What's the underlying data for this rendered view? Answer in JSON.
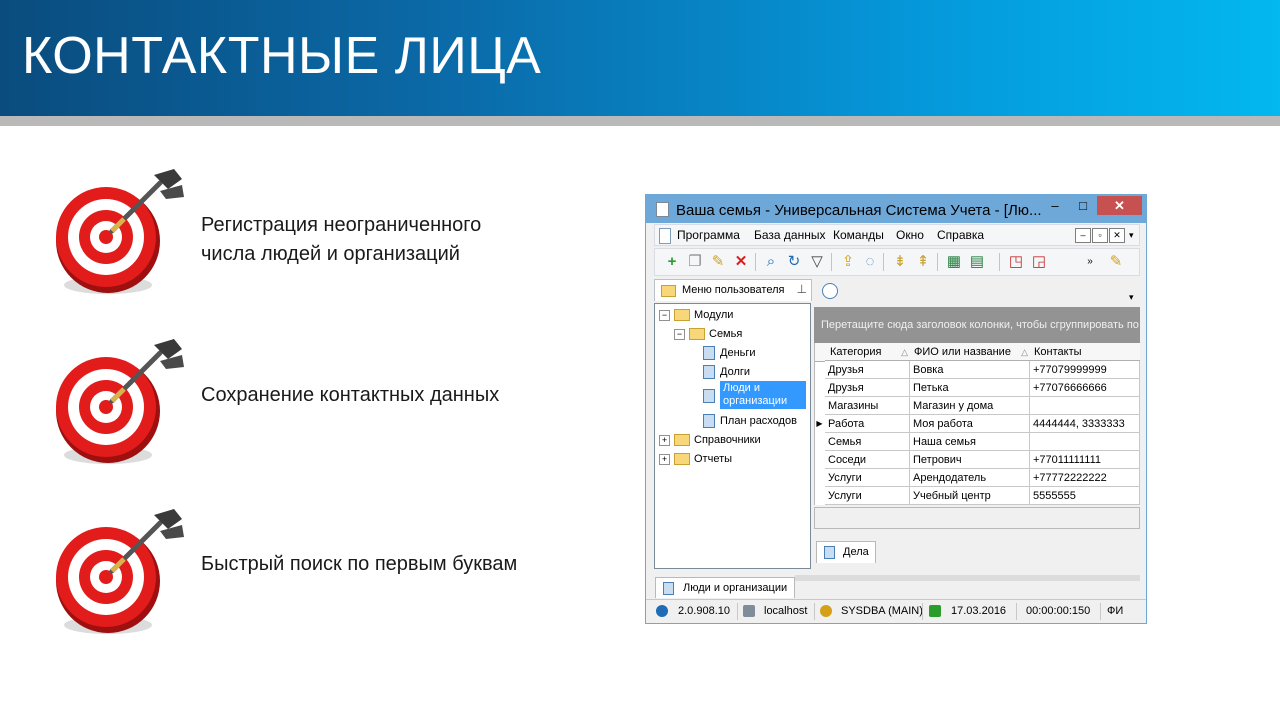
{
  "slide": {
    "title": "КОНТАКТНЫЕ ЛИЦА",
    "bullets": [
      "Регистрация неограниченного числа людей и организаций",
      "Сохранение контактных данных",
      "Быстрый поиск по первым буквам"
    ]
  },
  "window": {
    "title": "Ваша семья - Универсальная Система Учета - [Лю...",
    "controls": {
      "minimize": "–",
      "maximize": "□",
      "close": "✕"
    }
  },
  "menu": {
    "items": [
      "Программа",
      "База данных",
      "Команды",
      "Окно",
      "Справка"
    ]
  },
  "toolbar": {
    "buttons": [
      "add-icon",
      "copy-icon",
      "edit-icon",
      "delete-icon",
      "search-icon",
      "refresh-icon",
      "filter-icon",
      "export-icon",
      "comment-icon",
      "tree-expand-icon",
      "tree-collapse-icon",
      "excel-export-icon",
      "excel-import-icon",
      "new-window-icon",
      "close-window-icon",
      "settings-icon"
    ]
  },
  "left_panel": {
    "header": "Меню пользователя",
    "tree": [
      {
        "label": "Модули",
        "level": 0,
        "expanded": true
      },
      {
        "label": "Семья",
        "level": 1,
        "expanded": true
      },
      {
        "label": "Деньги",
        "level": 2
      },
      {
        "label": "Долги",
        "level": 2
      },
      {
        "label": "Люди и организации",
        "level": 2,
        "selected": true
      },
      {
        "label": "План расходов",
        "level": 2
      },
      {
        "label": "Справочники",
        "level": 0,
        "expanded": false
      },
      {
        "label": "Отчеты",
        "level": 0,
        "expanded": false
      }
    ]
  },
  "grid": {
    "group_hint": "Перетащите сюда заголовок колонки, чтобы сгруппировать по",
    "columns": [
      "Категория",
      "ФИО или название",
      "Контакты"
    ],
    "rows": [
      [
        "Друзья",
        "Вовка",
        "+77079999999"
      ],
      [
        "Друзья",
        "Петька",
        "+77076666666"
      ],
      [
        "Магазины",
        "Магазин у дома",
        ""
      ],
      [
        "Работа",
        "Моя работа",
        "4444444, 3333333"
      ],
      [
        "Семья",
        "Наша семья",
        ""
      ],
      [
        "Соседи",
        "Петрович",
        "+77011111111"
      ],
      [
        "Услуги",
        "Арендодатель",
        "+77772222222"
      ],
      [
        "Услуги",
        "Учебный центр",
        "5555555"
      ]
    ],
    "current_row": 3
  },
  "bottom_tabs": {
    "detail_tab": "Дела",
    "document_tab": "Люди и организации"
  },
  "status": {
    "version": "2.0.908.10",
    "server": "localhost",
    "user": "SYSDBA (MAIN)",
    "date": "17.03.2016",
    "timer": "00:00:00:150",
    "extra": "ФИ"
  },
  "colors": {
    "banner_dark": "#0a4c7e",
    "banner_light": "#03b8ef",
    "window_frame": "#6ea8d8",
    "selection": "#3399ff",
    "close_button": "#c75050"
  }
}
